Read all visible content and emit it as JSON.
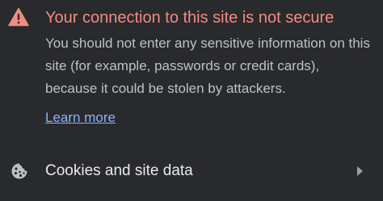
{
  "connection_warning": {
    "title": "Your connection to this site is not secure",
    "body": "You should not enter any sensitive information on this site (for example, passwords or credit cards), because it could be stolen by attackers.",
    "learn_more": "Learn more",
    "icon": "warning-triangle-icon"
  },
  "cookies": {
    "label": "Cookies and site data",
    "icon": "cookie-icon",
    "chevron": "chevron-right-icon"
  },
  "colors": {
    "background": "#292a2d",
    "warning_text": "#f28b82",
    "body_text": "#bdc1c6",
    "link": "#8ab4f8",
    "primary_text": "#e8eaed"
  }
}
